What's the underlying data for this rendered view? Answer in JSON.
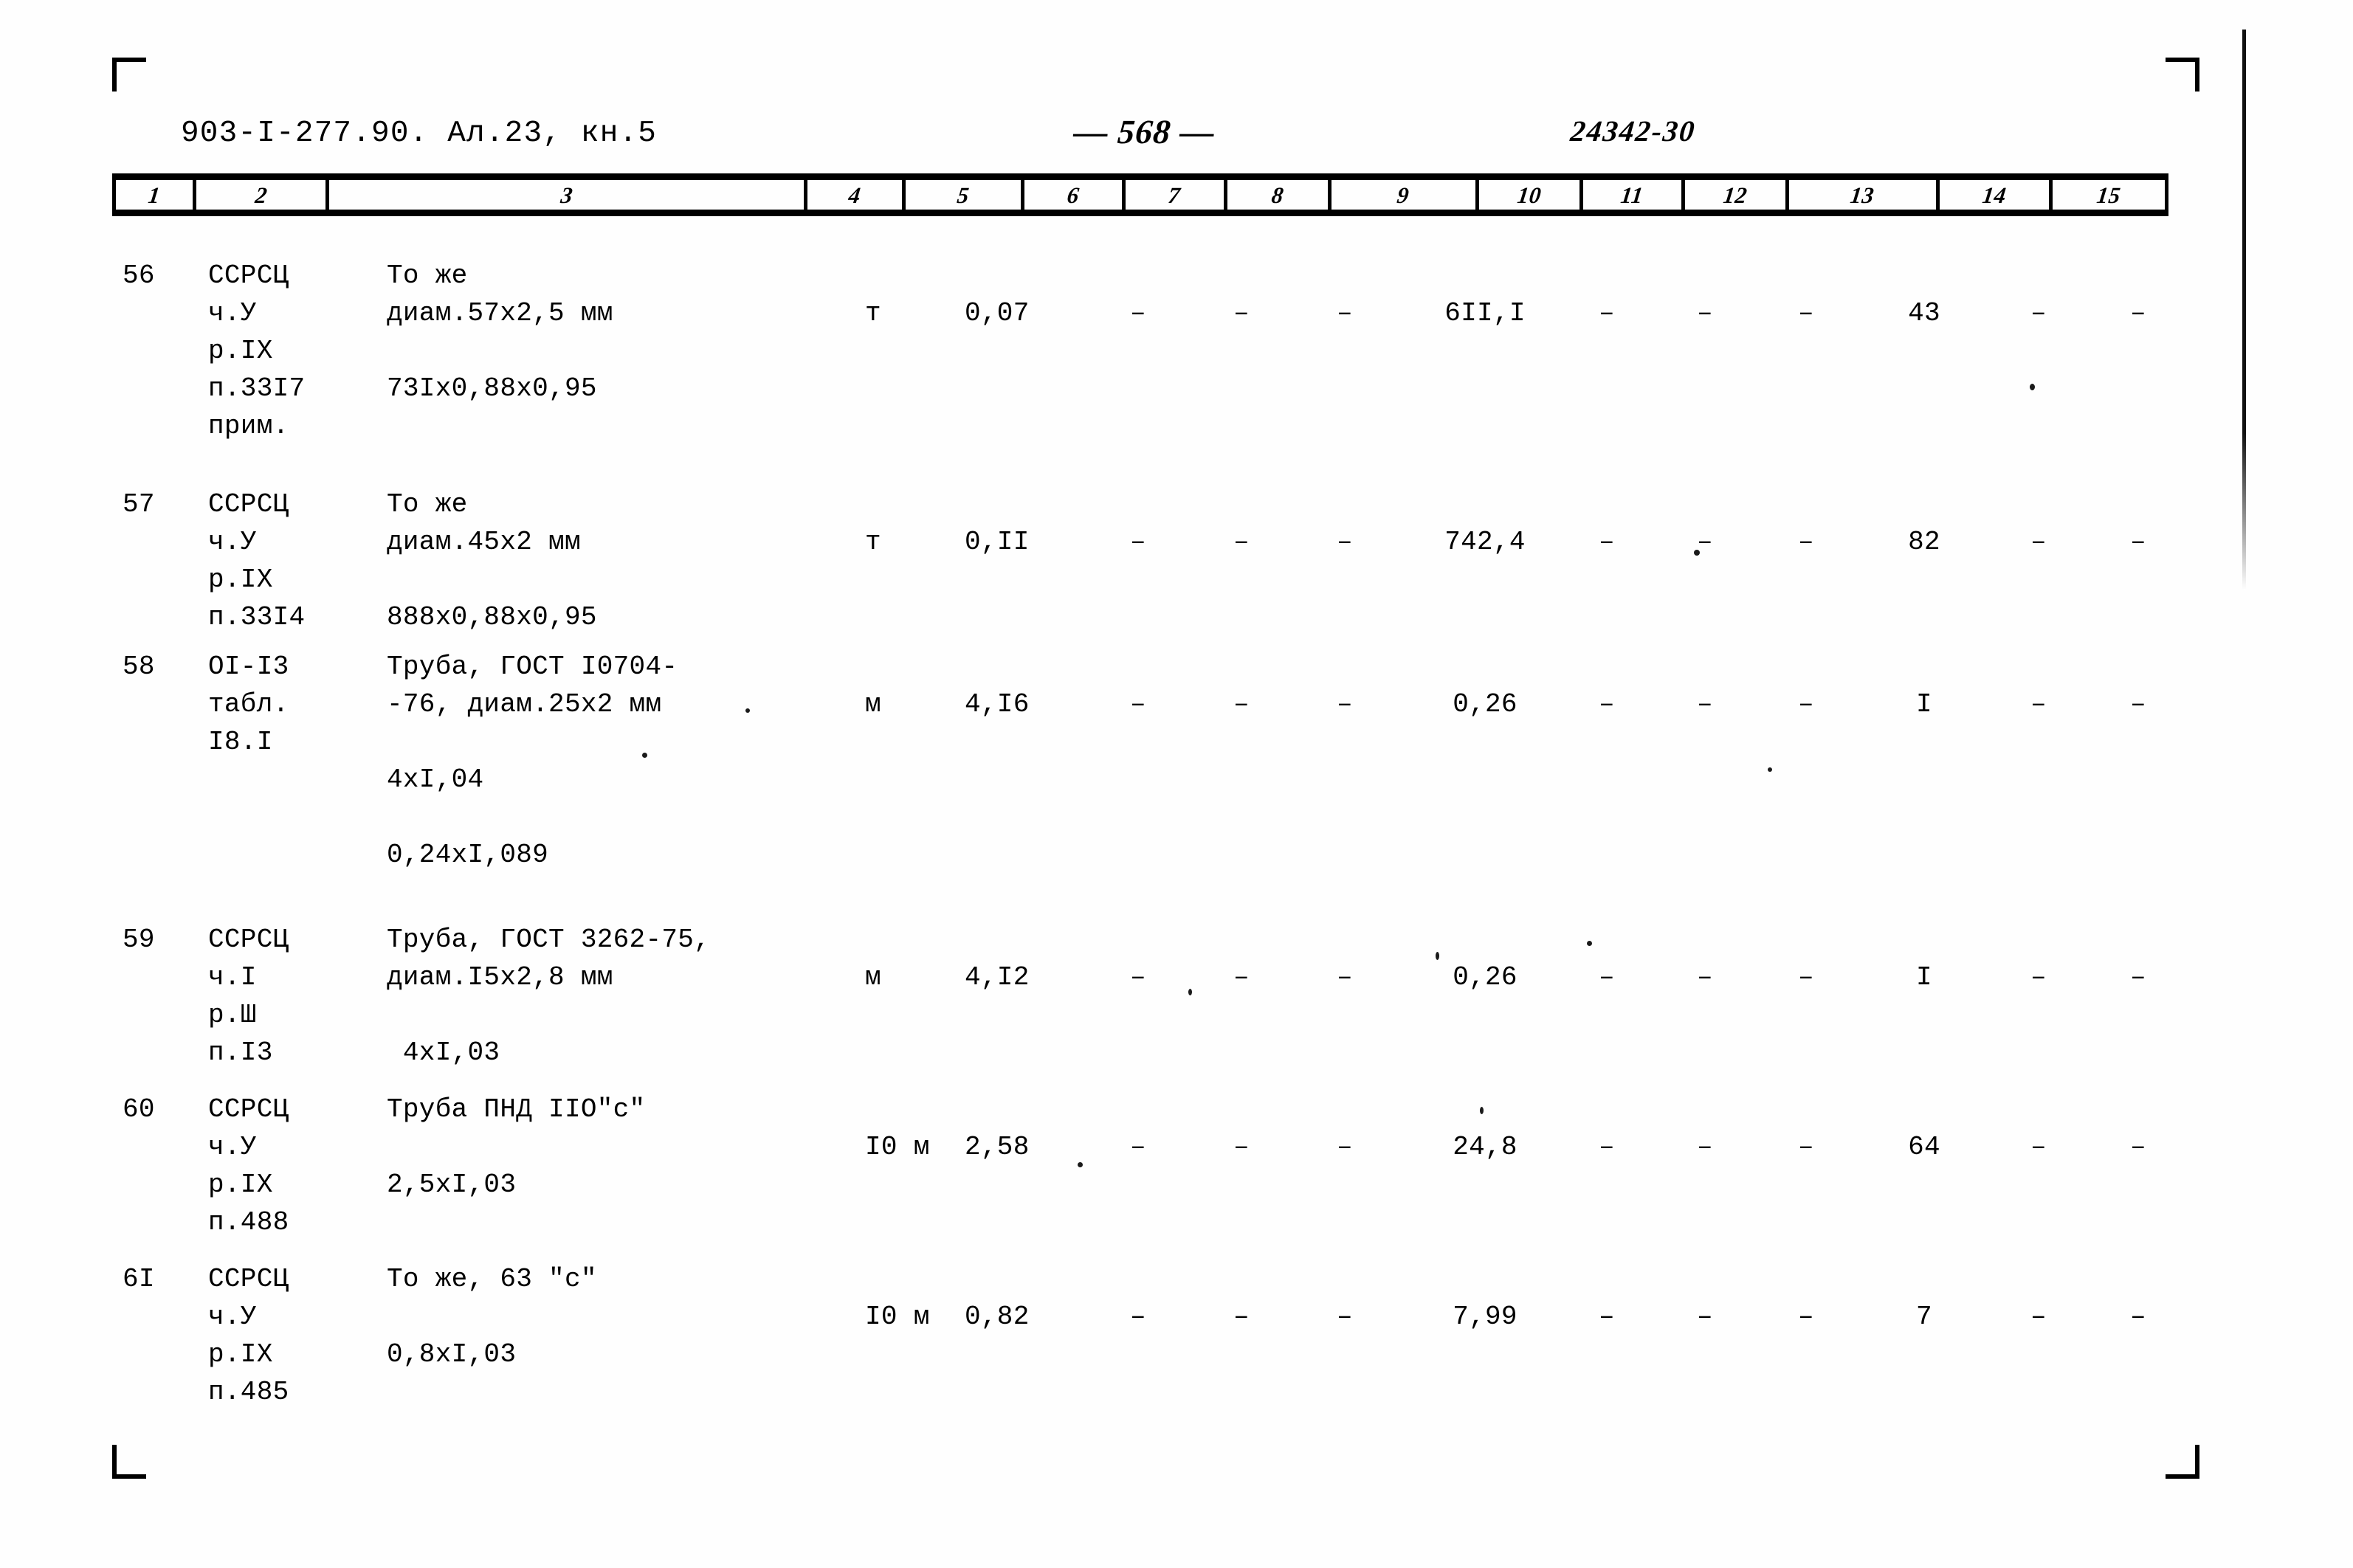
{
  "header": {
    "doc_code": "903-I-277.90. Ал.23, кн.5",
    "page_number": "— 568 —",
    "archive_number": "24342-30"
  },
  "table": {
    "column_numbers": [
      "1",
      "2",
      "3",
      "4",
      "5",
      "6",
      "7",
      "8",
      "9",
      "10",
      "11",
      "12",
      "13",
      "14",
      "15"
    ],
    "rows": [
      {
        "num": "56",
        "code": "ССРСЦ\nч.У\nр.IX\nп.33I7\nприм.",
        "desc": "То же\nдиам.57х2,5 мм\n\n73Iх0,88х0,95",
        "unit": "т",
        "qty": "0,07",
        "c6": "–",
        "c7": "–",
        "c8": "–",
        "c9": "6II,I",
        "c10": "–",
        "c11": "–",
        "c12": "–",
        "c13": "43",
        "c14": "–",
        "c15": "–"
      },
      {
        "num": "57",
        "code": "ССРСЦ\nч.У\nр.IX\nп.33I4",
        "desc": "То же\nдиам.45х2 мм\n\n888х0,88х0,95",
        "unit": "т",
        "qty": "0,II",
        "c6": "–",
        "c7": "–",
        "c8": "–",
        "c9": "742,4",
        "c10": "–",
        "c11": "–",
        "c12": "–",
        "c13": "82",
        "c14": "–",
        "c15": "–"
      },
      {
        "num": "58",
        "code": "OI-I3\nтабл.\nI8.I",
        "desc": "Труба, ГОСТ I0704-\n-76, диам.25х2 мм\n\n4хI,04\n\n0,24хI,089",
        "unit": "м",
        "qty": "4,I6",
        "c6": "–",
        "c7": "–",
        "c8": "–",
        "c9": "0,26",
        "c10": "–",
        "c11": "–",
        "c12": "–",
        "c13": "I",
        "c14": "–",
        "c15": "–"
      },
      {
        "num": "59",
        "code": "ССРСЦ\nч.I\nр.Ш\nп.I3",
        "desc": "Труба, ГОСТ 3262-75,\nдиам.I5х2,8 мм\n\n 4хI,03",
        "unit": "м",
        "qty": "4,I2",
        "c6": "–",
        "c7": "–",
        "c8": "–",
        "c9": "0,26",
        "c10": "–",
        "c11": "–",
        "c12": "–",
        "c13": "I",
        "c14": "–",
        "c15": "–"
      },
      {
        "num": "60",
        "code": "ССРСЦ\nч.У\nр.IX\nп.488",
        "desc": "Труба ПНД IIO\"с\"\n\n2,5хI,03",
        "unit": "I0 м",
        "qty": "2,58",
        "c6": "–",
        "c7": "–",
        "c8": "–",
        "c9": "24,8",
        "c10": "–",
        "c11": "–",
        "c12": "–",
        "c13": "64",
        "c14": "–",
        "c15": "–"
      },
      {
        "num": "6I",
        "code": "ССРСЦ\nч.У\nр.IX\nп.485",
        "desc": "То же, 63 \"с\"\n\n0,8хI,03",
        "unit": "I0 м",
        "qty": "0,82",
        "c6": "–",
        "c7": "–",
        "c8": "–",
        "c9": "7,99",
        "c10": "–",
        "c11": "–",
        "c12": "–",
        "c13": "7",
        "c14": "–",
        "c15": "–"
      }
    ]
  }
}
